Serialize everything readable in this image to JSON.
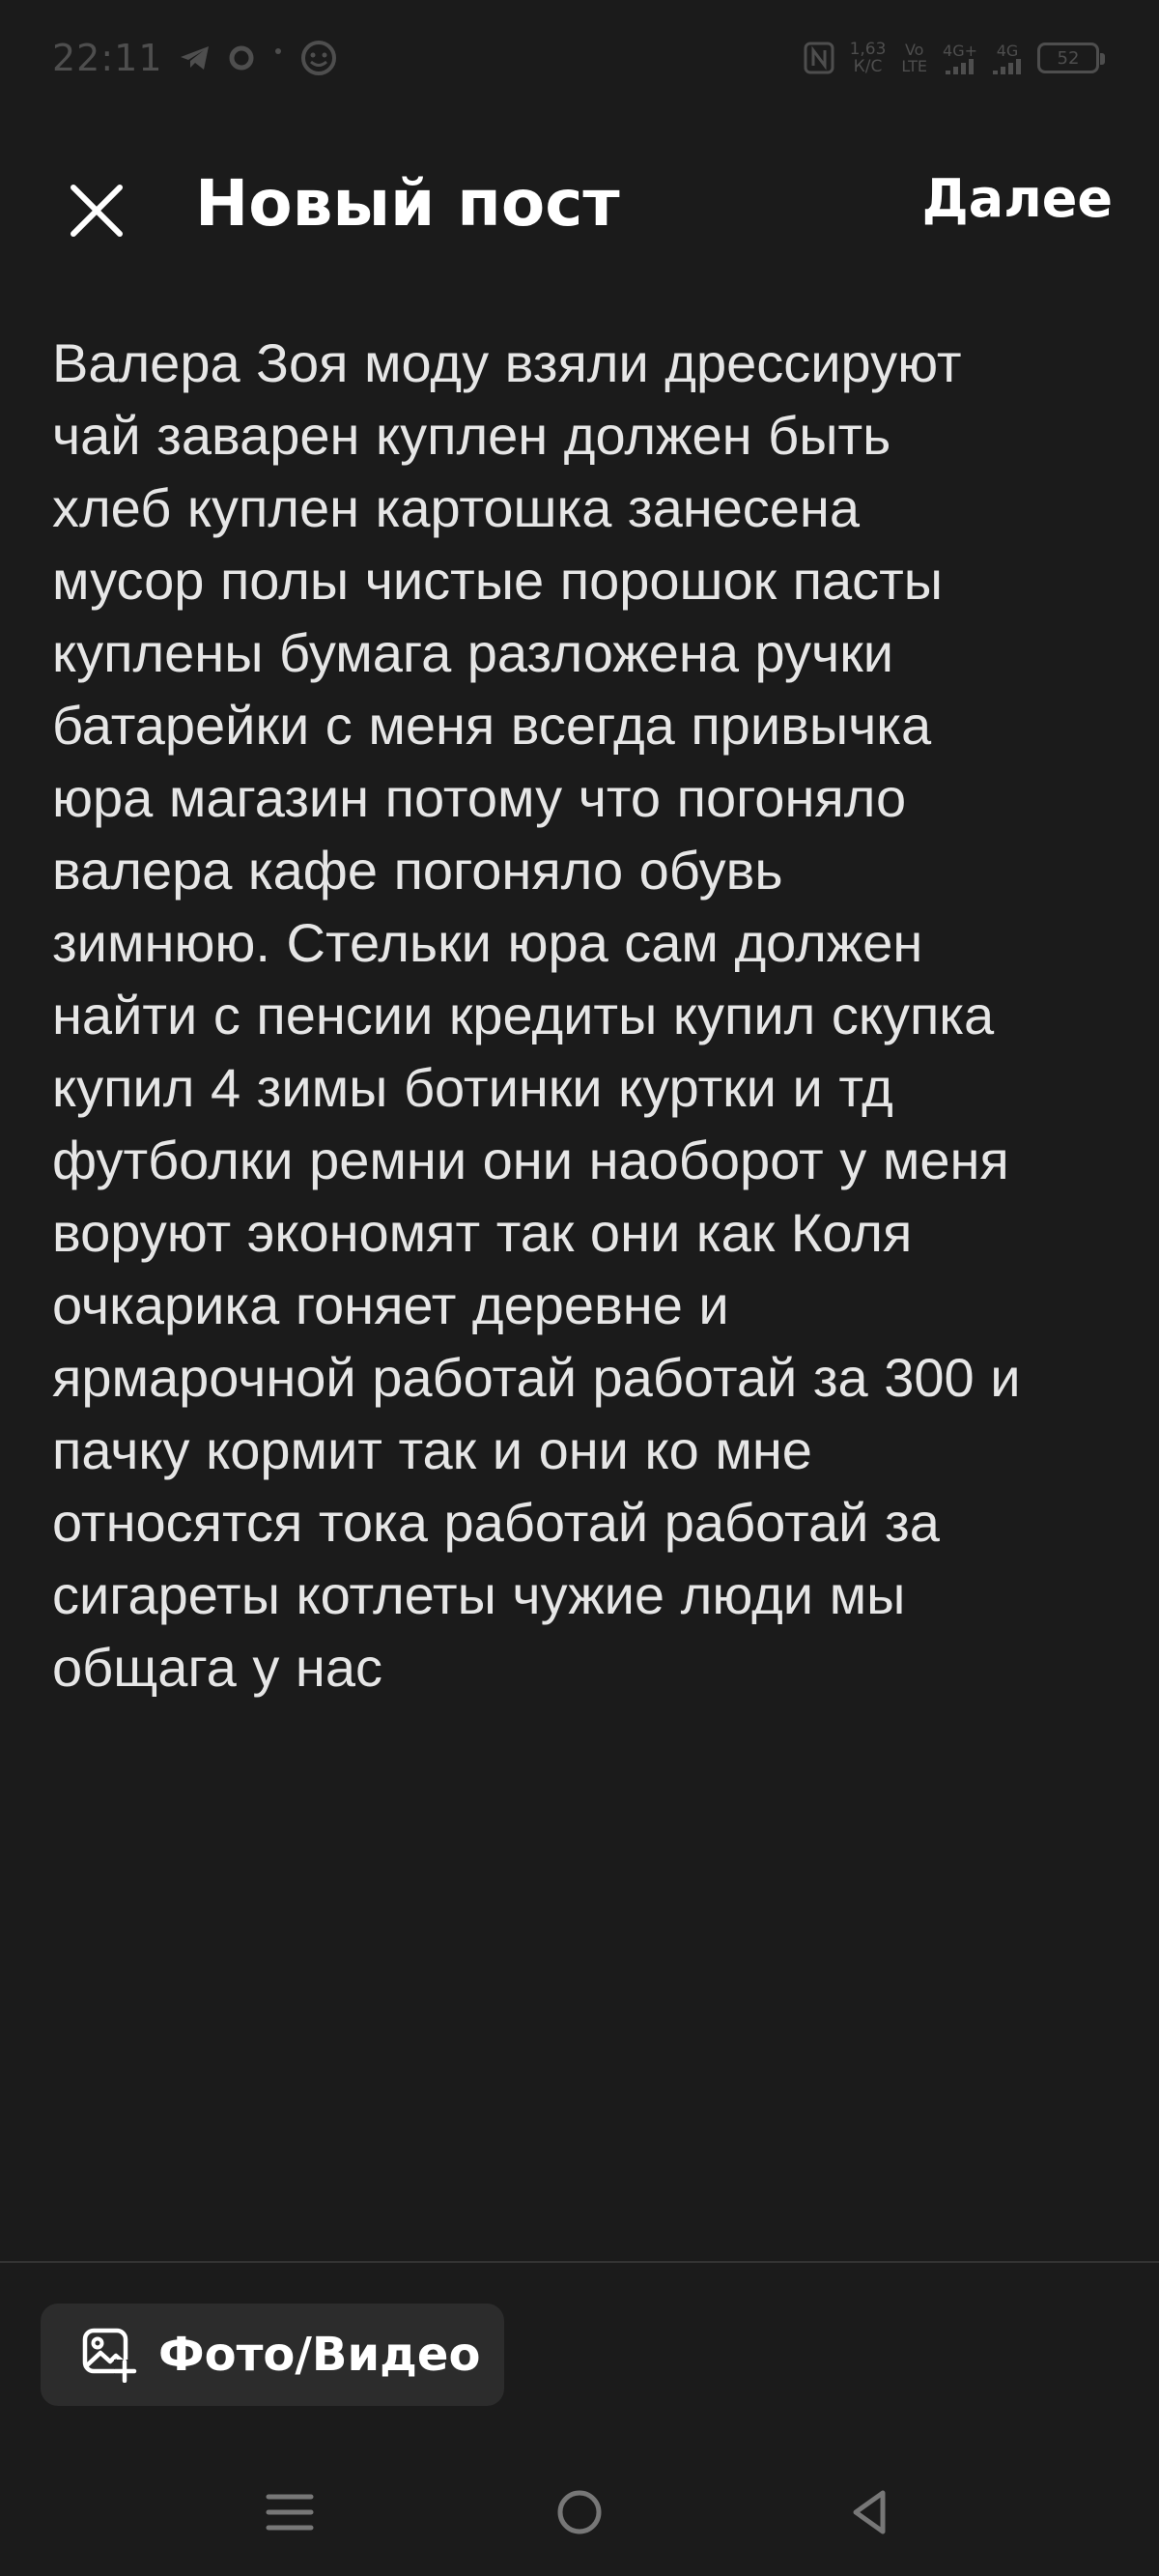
{
  "status_bar": {
    "time": "22:11",
    "net_speed_value": "1,63",
    "net_speed_unit": "К/С",
    "signal_1_top": "Vo",
    "signal_1_bottom": "LTE",
    "signal_1_gen": "4G+",
    "signal_2_gen": "4G",
    "battery_level": "52",
    "icons": [
      "telegram-icon",
      "sync-icon",
      "dot-icon",
      "face-icon",
      "nfc-icon",
      "signal-icon",
      "battery-icon"
    ]
  },
  "header": {
    "title": "Новый пост",
    "next_label": "Далее"
  },
  "post": {
    "text": "Валера Зоя моду взяли дрессируют\nчай заварен куплен должен быть\nхлеб куплен картошка занесена\nмусор полы чистые порошок пасты\nкуплены бумага разложена ручки\nбатарейки с меня всегда привычка\nюра магазин потому что погоняло\nвалера кафе погоняло обувь\nзимнюю. Стельки юра сам должен\nнайти с пенсии кредиты купил скупка\nкупил 4 зимы ботинки куртки и тд\nфутболки ремни они наоборот у меня\nворуют экономят так они как Коля\nочкарика гоняет деревне и\nярмарочной работай работай за 300 и\nпачку кормит так и они ко мне\nотносятся тока работай работай за\nсигареты котлеты чужие люди мы\nобщага у нас"
  },
  "bottom": {
    "media_label": "Фото/Видео"
  },
  "colors": {
    "background": "#1b1b1b",
    "text": "#ffffff",
    "body_text": "#e6e6e6",
    "button_bg": "#2c2c2c",
    "status_gray": "#4e4e4e"
  }
}
